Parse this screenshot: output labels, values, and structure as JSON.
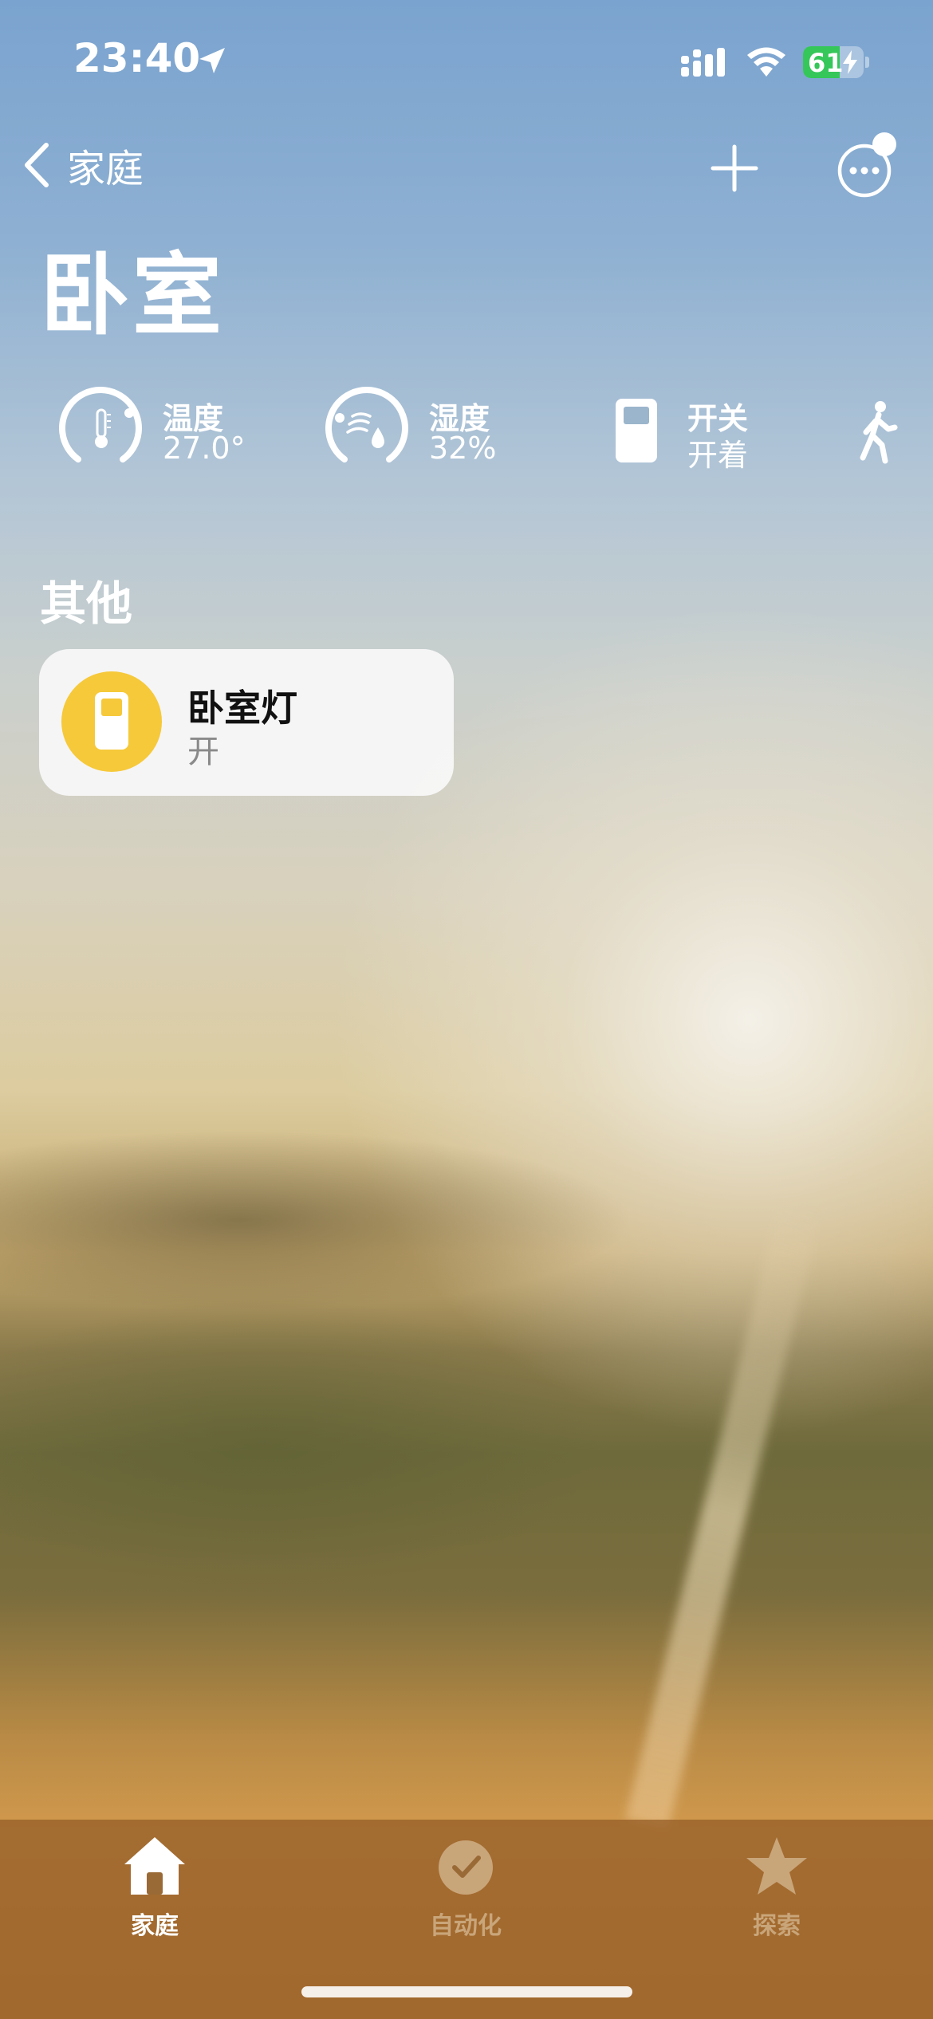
{
  "status_bar": {
    "time": "23:40",
    "battery_percent": "61",
    "battery_level": 0.61,
    "icons": [
      "location-arrow-icon",
      "cellular-signal-icon",
      "wifi-icon",
      "battery-charging-icon"
    ]
  },
  "nav": {
    "back_label": "家庭",
    "back_icon": "chevron-left-icon",
    "add_icon": "plus-icon",
    "more_icon": "ellipsis-circle-icon"
  },
  "page_title": "卧室",
  "statuses": [
    {
      "label": "温度",
      "value": "27.0°",
      "icon": "thermometer-gauge-icon"
    },
    {
      "label": "湿度",
      "value": "32%",
      "icon": "humidity-gauge-icon"
    },
    {
      "label": "开关",
      "value": "开着",
      "icon": "switch-icon"
    },
    {
      "icon": "motion-sensor-icon"
    }
  ],
  "section_other": "其他",
  "accessory": {
    "name": "卧室灯",
    "state": "开",
    "icon": "switch-icon",
    "accent": "#f6c93a"
  },
  "tabs": [
    {
      "label": "家庭",
      "icon": "house-icon",
      "active": true
    },
    {
      "label": "自动化",
      "icon": "clock-check-icon",
      "active": false
    },
    {
      "label": "探索",
      "icon": "star-icon",
      "active": false
    }
  ],
  "colors": {
    "accent_yellow": "#f6c93a",
    "battery_green": "#35c759",
    "tab_inactive": "#c9a57a"
  }
}
